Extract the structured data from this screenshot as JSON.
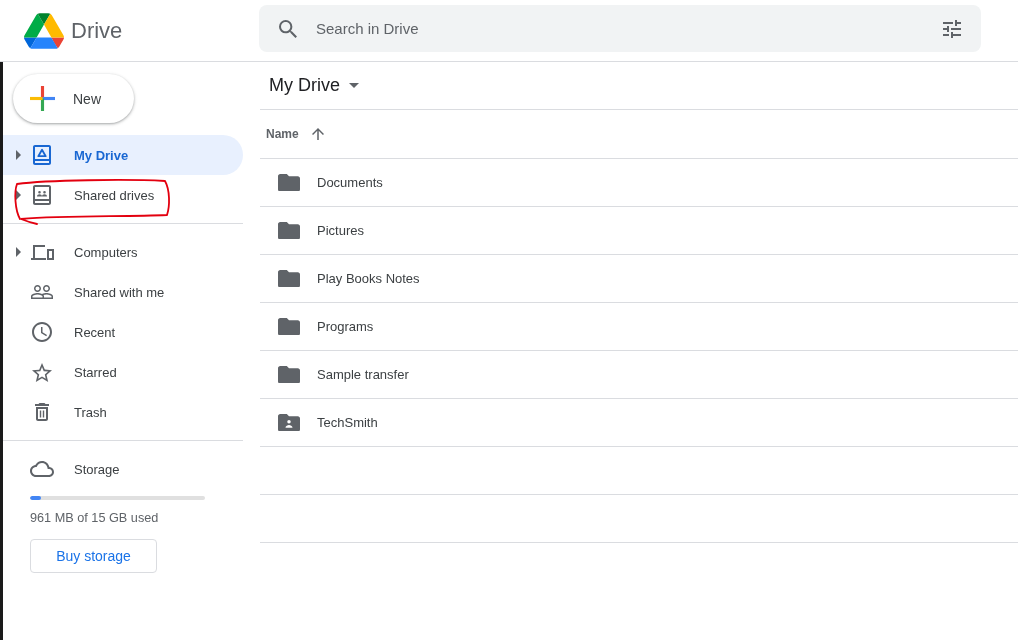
{
  "app": {
    "name": "Drive"
  },
  "search": {
    "placeholder": "Search in Drive"
  },
  "sidebar": {
    "new_button": {
      "label": "New"
    },
    "groups": [
      {
        "items": [
          {
            "label": "My Drive",
            "selected": true,
            "expandable": true,
            "circled": false
          },
          {
            "label": "Shared drives",
            "selected": false,
            "expandable": true,
            "circled": true
          }
        ]
      },
      {
        "items": [
          {
            "label": "Computers",
            "selected": false,
            "expandable": true,
            "circled": false
          },
          {
            "label": "Shared with me",
            "selected": false,
            "expandable": false,
            "circled": false
          },
          {
            "label": "Recent",
            "selected": false,
            "expandable": false,
            "circled": false
          },
          {
            "label": "Starred",
            "selected": false,
            "expandable": false,
            "circled": false
          },
          {
            "label": "Trash",
            "selected": false,
            "expandable": false,
            "circled": false
          }
        ]
      }
    ],
    "storage": {
      "label": "Storage",
      "level": 0.064,
      "usage": "961 MB of 15 GB used",
      "button": "Buy storage"
    }
  },
  "main": {
    "title": "My Drive",
    "columns": [
      {
        "label": "Name",
        "sort_ascending": true
      }
    ],
    "rows": [
      {
        "name": "Documents",
        "kind": "folder"
      },
      {
        "name": "Pictures",
        "kind": "folder"
      },
      {
        "name": "Play Books Notes",
        "kind": "folder"
      },
      {
        "name": "Programs",
        "kind": "folder"
      },
      {
        "name": "Sample transfer",
        "kind": "folder"
      },
      {
        "name": "TechSmith",
        "kind": "shared_folder"
      }
    ]
  }
}
